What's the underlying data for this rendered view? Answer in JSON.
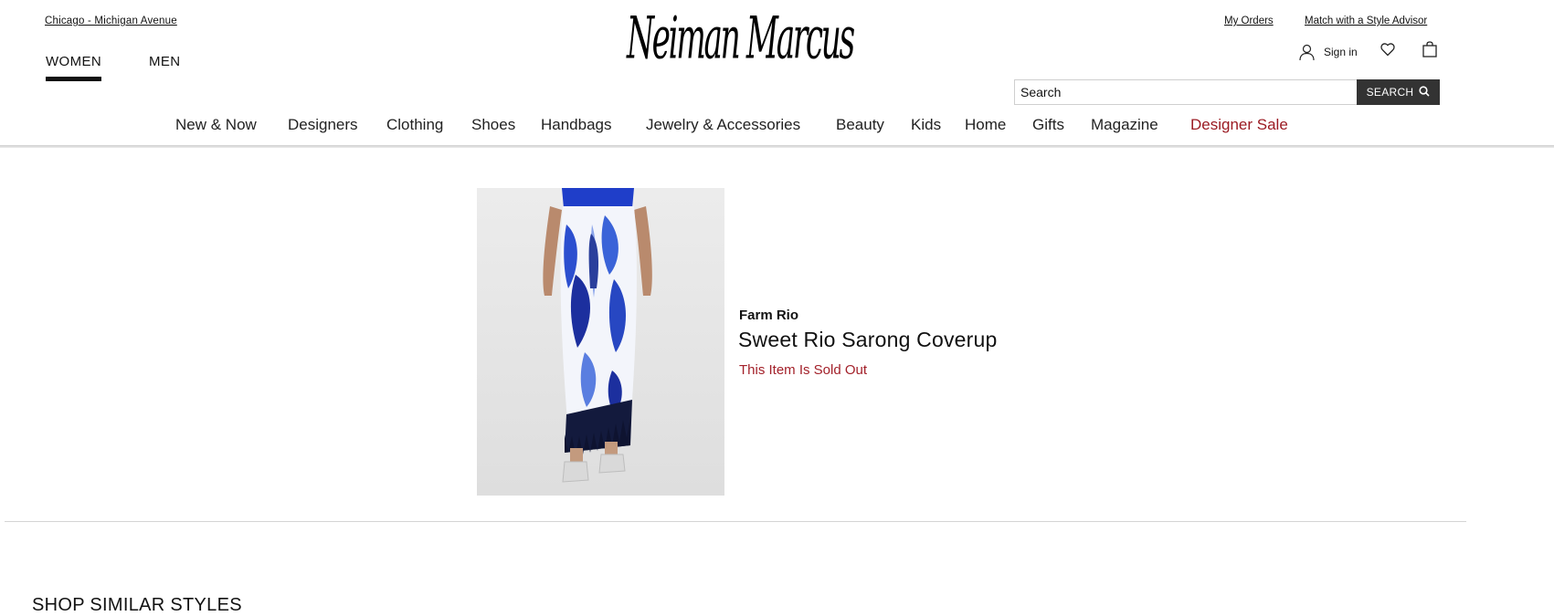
{
  "header": {
    "store_link": "Chicago - Michigan Avenue",
    "gender_tabs": [
      {
        "label": "WOMEN",
        "active": true
      },
      {
        "label": "MEN",
        "active": false
      }
    ],
    "logo_text": "Neiman Marcus",
    "util_links": {
      "my_orders": "My Orders",
      "style_advisor": "Match with a Style Advisor"
    },
    "sign_in_label": "Sign in",
    "icons": {
      "user": "user-icon",
      "wishlist": "heart-icon",
      "bag": "shopping-bag-icon",
      "search": "search-icon"
    },
    "search": {
      "placeholder": "Search",
      "button_label": "SEARCH"
    }
  },
  "categories": [
    {
      "label": "New & Now"
    },
    {
      "label": "Designers"
    },
    {
      "label": "Clothing"
    },
    {
      "label": "Shoes"
    },
    {
      "label": "Handbags"
    },
    {
      "label": "Jewelry & Accessories"
    },
    {
      "label": "Beauty"
    },
    {
      "label": "Kids"
    },
    {
      "label": "Home"
    },
    {
      "label": "Gifts"
    },
    {
      "label": "Magazine"
    },
    {
      "label": "Designer Sale",
      "highlight": true
    }
  ],
  "product": {
    "brand": "Farm Rio",
    "name": "Sweet Rio Sarong Coverup",
    "status": "This Item Is Sold Out",
    "image_alt": "sarong-product-image"
  },
  "similar": {
    "heading": "SHOP SIMILAR STYLES"
  },
  "colors": {
    "accent_red": "#9b1b23",
    "search_button": "#333333"
  }
}
